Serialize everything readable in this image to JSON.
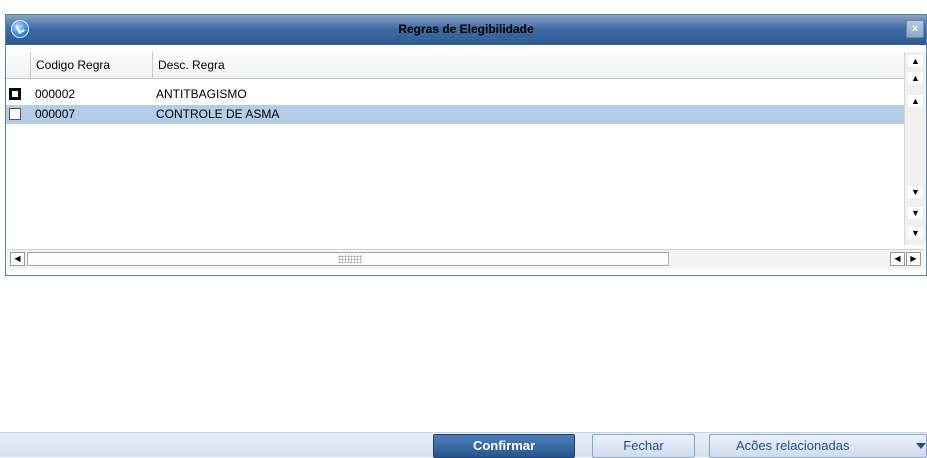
{
  "dialog": {
    "title": "Regras de Elegibilidade",
    "close_label": "×"
  },
  "grid": {
    "columns": [
      "",
      "Codigo Regra",
      "Desc. Regra"
    ],
    "rows": [
      {
        "checked": false,
        "codigo": "000002",
        "descricao": "ANTITBAGISMO",
        "focused": true,
        "selected": false
      },
      {
        "checked": false,
        "codigo": "000007",
        "descricao": "CONTROLE DE ASMA",
        "focused": false,
        "selected": true
      }
    ],
    "vscroll_icons": [
      "scroll-first-icon",
      "page-up-icon",
      "scroll-up-icon",
      "scroll-down-icon",
      "page-down-icon",
      "scroll-last-icon"
    ],
    "hscroll_icons": [
      "scroll-left-icon",
      "scroll-right-icon"
    ]
  },
  "buttons": {
    "confirm": "Confirmar",
    "close": "Fechar",
    "actions": "Acões relacionadas"
  },
  "colors": {
    "titlebar": "#3f6aa2",
    "selected_row": "#b4cce6",
    "confirm_button": "#27568f"
  }
}
